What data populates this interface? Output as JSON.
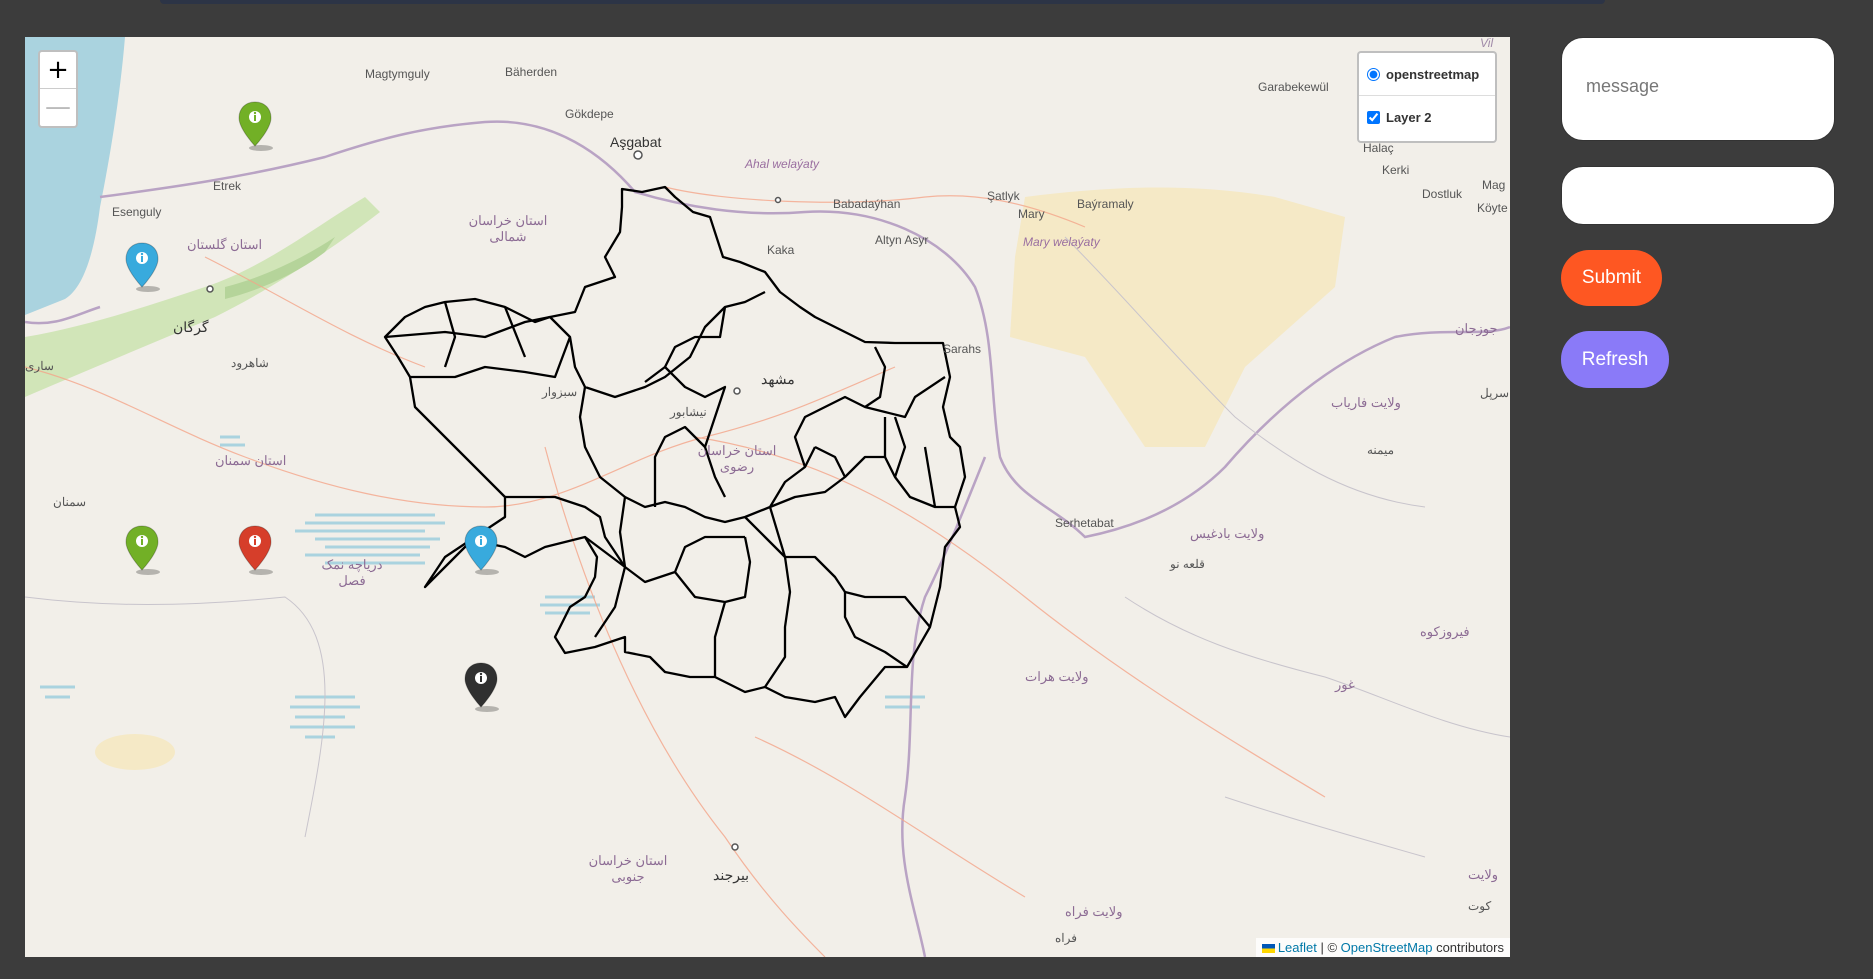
{
  "map": {
    "zoom_in": "+",
    "zoom_out": "—",
    "layers": {
      "base": "openstreetmap",
      "overlay": "Layer 2"
    },
    "attribution": {
      "leaflet": "Leaflet",
      "separator": " | © ",
      "osm": "OpenStreetMap",
      "contributors": " contributors"
    },
    "labels": {
      "magtymguly": "Magtymguly",
      "baherden": "Bäherden",
      "gokdepe": "Gökdepe",
      "asgabat": "Aşgabat",
      "ahal": "Ahal welaýaty",
      "babadayhan": "Babadaýhan",
      "satlyk": "Şatlyk",
      "mary": "Mary",
      "bayramaly": "Baýramaly",
      "altyn_asyr": "Altyn Asyr",
      "mary_wel": "Mary welaýaty",
      "kaka": "Kaka",
      "garabekewul": "Garabekewül",
      "halac": "Halaç",
      "kerki": "Kerki",
      "dostluk": "Dostluk",
      "mag": "Mag",
      "koyte": "Köyte",
      "etrek": "Etrek",
      "esenguly": "Esenguly",
      "golestan": "استان گلستان",
      "gorgan": "گرگان",
      "sari": "ساری",
      "shahrud": "شاهرود",
      "semnan_ostan": "استان سمنان",
      "semnan": "سمنان",
      "khorasan_shomali": "استان خراسان شمالی",
      "sabzevar": "سبزوار",
      "neyshabur": "نیشابور",
      "mashhad": "مشهد",
      "razavi": "استان خراسان رضوی",
      "sarahs": "Sarahs",
      "serhetabat": "Serhetabat",
      "badghis": "ولایت بادغیس",
      "qala_now": "قلعه نو",
      "faryab": "ولایت فاریاب",
      "maymana": "میمنه",
      "jowzjan": "جوزجان",
      "sarpol": "سرپل",
      "firozkoh": "فیروزکوه",
      "ghor": "غور",
      "herat": "ولایت هرات",
      "daryache": "دریاچه نمک فصل",
      "khorasan_jonubi": "استان خراسان جنوبی",
      "birjand": "بیرجند",
      "farah_wel": "ولایت فراه",
      "farah": "فراه",
      "vil": "Vil",
      "velayat": "ولایت",
      "kut": "کوت"
    },
    "markers": [
      {
        "color": "#72b026",
        "name": "marker-green-north"
      },
      {
        "color": "#38aadd",
        "name": "marker-blue-caspian"
      },
      {
        "color": "#72b026",
        "name": "marker-green-west"
      },
      {
        "color": "#d63e2a",
        "name": "marker-red"
      },
      {
        "color": "#38aadd",
        "name": "marker-blue-center"
      },
      {
        "color": "#303030",
        "name": "marker-black"
      }
    ],
    "colors": {
      "water": "#aad3df",
      "forest": "#cde3b3",
      "desert": "#f5e9c6",
      "border": "#b9a3c4",
      "district": "#000000"
    }
  },
  "form": {
    "message_placeholder": "message",
    "second_value": "",
    "submit_label": "Submit",
    "refresh_label": "Refresh",
    "submit_color": "#fe5722",
    "refresh_color": "#8a7af8"
  }
}
